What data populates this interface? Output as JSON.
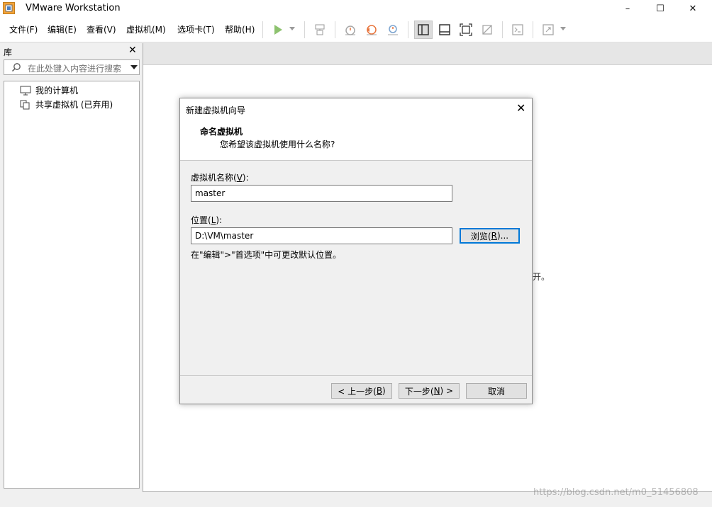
{
  "window": {
    "title": "VMware Workstation",
    "minimize": "–",
    "maximize": "☐",
    "close": "✕"
  },
  "menu": {
    "items": [
      "文件(F)",
      "编辑(E)",
      "查看(V)",
      "虚拟机(M)",
      "选项卡(T)",
      "帮助(H)"
    ]
  },
  "library": {
    "title": "库",
    "close": "✕",
    "search_placeholder": "在此处键入内容进行搜索",
    "items": [
      "我的计算机",
      "共享虚拟机 (已弃用)"
    ]
  },
  "main": {
    "background_fragment": "开。",
    "watermark": "https://blog.csdn.net/m0_51456808"
  },
  "dialog": {
    "title": "新建虚拟机向导",
    "close": "✕",
    "heading": "命名虚拟机",
    "subheading": "您希望该虚拟机使用什么名称?",
    "name_label_pre": "虚拟机名称(",
    "name_label_key": "V",
    "name_label_post": "):",
    "name_value": "master",
    "location_label_pre": "位置(",
    "location_label_key": "L",
    "location_label_post": "):",
    "location_value": "D:\\VM\\master",
    "browse_pre": "浏览(",
    "browse_key": "R",
    "browse_post": ")...",
    "hint": "在\"编辑\">\"首选项\"中可更改默认位置。",
    "back_pre": "< 上一步(",
    "back_key": "B",
    "back_post": ")",
    "next_pre": "下一步(",
    "next_key": "N",
    "next_post": ") >",
    "cancel": "取消"
  },
  "colors": {
    "accent": "#0078d7",
    "play": "#8dc26f",
    "snapshot_orange": "#e8733a"
  }
}
